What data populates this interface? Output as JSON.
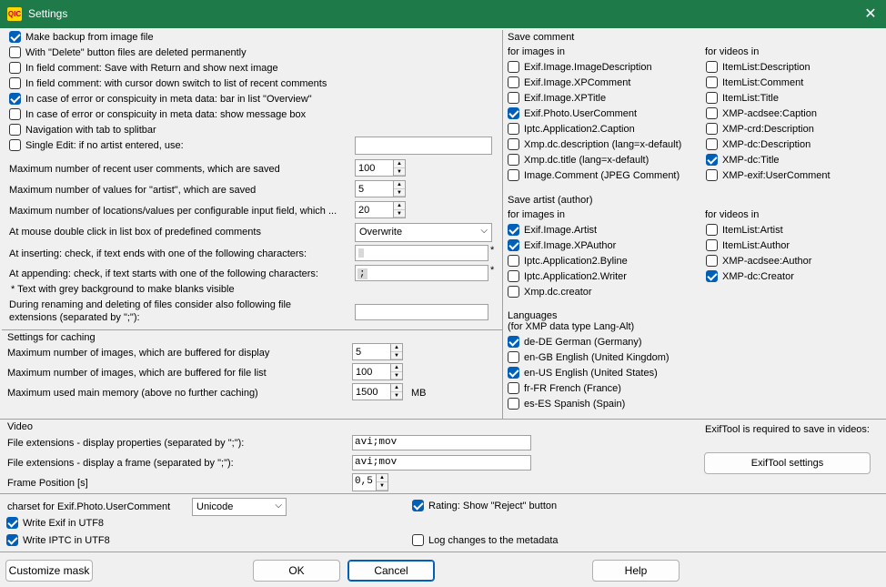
{
  "window": {
    "title": "Settings",
    "logo_text": "QIC"
  },
  "general": {
    "make_backup": "Make backup from image file",
    "delete_permanent": "With \"Delete\" button files are deleted permanently",
    "save_return": "In field comment: Save with Return and show next image",
    "cursor_down": "In field comment: with cursor down switch to list of recent comments",
    "error_bar": "In case of error or conspicuity in meta data: bar in list \"Overview\"",
    "error_msgbox": "In case of error or conspicuity in meta data: show message box",
    "nav_tab": "Navigation with tab to splitbar",
    "single_edit": "Single Edit: if no artist entered, use:",
    "max_comments_label": "Maximum number of recent user comments, which are saved",
    "max_comments_value": "100",
    "max_artist_label": "Maximum number of values for \"artist\", which are saved",
    "max_artist_value": "5",
    "max_locations_label": "Maximum number of locations/values per configurable input field, which ...",
    "max_locations_value": "20",
    "dblclick_label": "At mouse double click in list box of predefined comments",
    "dblclick_value": "Overwrite",
    "inserting_label": "At inserting: check, if text ends with one of the following characters:",
    "appending_label": "At appending: check, if text starts with one of the following characters:",
    "appending_value": ";",
    "asterisk": "*",
    "grey_note": "* Text with grey background to make blanks visible",
    "rename_label": "During renaming and deleting of files consider also following file extensions (separated by \";\"):"
  },
  "caching": {
    "header": "Settings for caching",
    "display_label": "Maximum number of images, which are buffered for display",
    "display_value": "5",
    "filelist_label": "Maximum number of images, which are buffered for file list",
    "filelist_value": "100",
    "memory_label": "Maximum used main memory (above no further caching)",
    "memory_value": "1500",
    "memory_unit": "MB"
  },
  "save_comment": {
    "header": "Save comment",
    "images_header": "for images in",
    "videos_header": "for videos in",
    "images": [
      {
        "label": "Exif.Image.ImageDescription",
        "checked": false
      },
      {
        "label": "Exif.Image.XPComment",
        "checked": false
      },
      {
        "label": "Exif.Image.XPTitle",
        "checked": false
      },
      {
        "label": "Exif.Photo.UserComment",
        "checked": true
      },
      {
        "label": "Iptc.Application2.Caption",
        "checked": false
      },
      {
        "label": "Xmp.dc.description (lang=x-default)",
        "checked": false
      },
      {
        "label": "Xmp.dc.title (lang=x-default)",
        "checked": false
      },
      {
        "label": "Image.Comment (JPEG Comment)",
        "checked": false
      }
    ],
    "videos": [
      {
        "label": "ItemList:Description",
        "checked": false
      },
      {
        "label": "ItemList:Comment",
        "checked": false
      },
      {
        "label": "ItemList:Title",
        "checked": false
      },
      {
        "label": "XMP-acdsee:Caption",
        "checked": false
      },
      {
        "label": "XMP-crd:Description",
        "checked": false
      },
      {
        "label": "XMP-dc:Description",
        "checked": false
      },
      {
        "label": "XMP-dc:Title",
        "checked": true
      },
      {
        "label": "XMP-exif:UserComment",
        "checked": false
      }
    ]
  },
  "save_artist": {
    "header": "Save artist (author)",
    "images_header": "for images in",
    "videos_header": "for videos in",
    "images": [
      {
        "label": "Exif.Image.Artist",
        "checked": true
      },
      {
        "label": "Exif.Image.XPAuthor",
        "checked": true
      },
      {
        "label": "Iptc.Application2.Byline",
        "checked": false
      },
      {
        "label": "Iptc.Application2.Writer",
        "checked": false
      },
      {
        "label": "Xmp.dc.creator",
        "checked": false
      }
    ],
    "videos": [
      {
        "label": "ItemList:Artist",
        "checked": false
      },
      {
        "label": "ItemList:Author",
        "checked": false
      },
      {
        "label": "XMP-acdsee:Author",
        "checked": false
      },
      {
        "label": "XMP-dc:Creator",
        "checked": true
      }
    ]
  },
  "languages": {
    "header": "Languages",
    "subheader": "(for XMP data type Lang-Alt)",
    "items": [
      {
        "label": "de-DE German (Germany)",
        "checked": true
      },
      {
        "label": "en-GB English (United Kingdom)",
        "checked": false
      },
      {
        "label": "en-US English (United States)",
        "checked": true
      },
      {
        "label": "fr-FR French (France)",
        "checked": false
      },
      {
        "label": "es-ES Spanish (Spain)",
        "checked": false
      }
    ]
  },
  "video": {
    "header": "Video",
    "props_label": "File extensions - display properties (separated by \";\"):",
    "props_value": "avi;mov",
    "frame_label": "File extensions - display a frame (separated by \";\"):",
    "frame_value": "avi;mov",
    "position_label": "Frame Position [s]",
    "position_value": "0,5",
    "exiftool_note": "ExifTool is required to save in videos:",
    "exiftool_button": "ExifTool settings"
  },
  "charset": {
    "label": "charset for Exif.Photo.UserComment",
    "value": "Unicode",
    "exif_utf8": "Write Exif in UTF8",
    "iptc_utf8": "Write IPTC in UTF8",
    "reject_button": "Rating: Show \"Reject\" button",
    "log_changes": "Log changes to the metadata"
  },
  "buttons": {
    "customize": "Customize mask",
    "ok": "OK",
    "cancel": "Cancel",
    "help": "Help"
  },
  "colors": {
    "titlebar": "#1f7a4a",
    "check": "#005fb8"
  }
}
